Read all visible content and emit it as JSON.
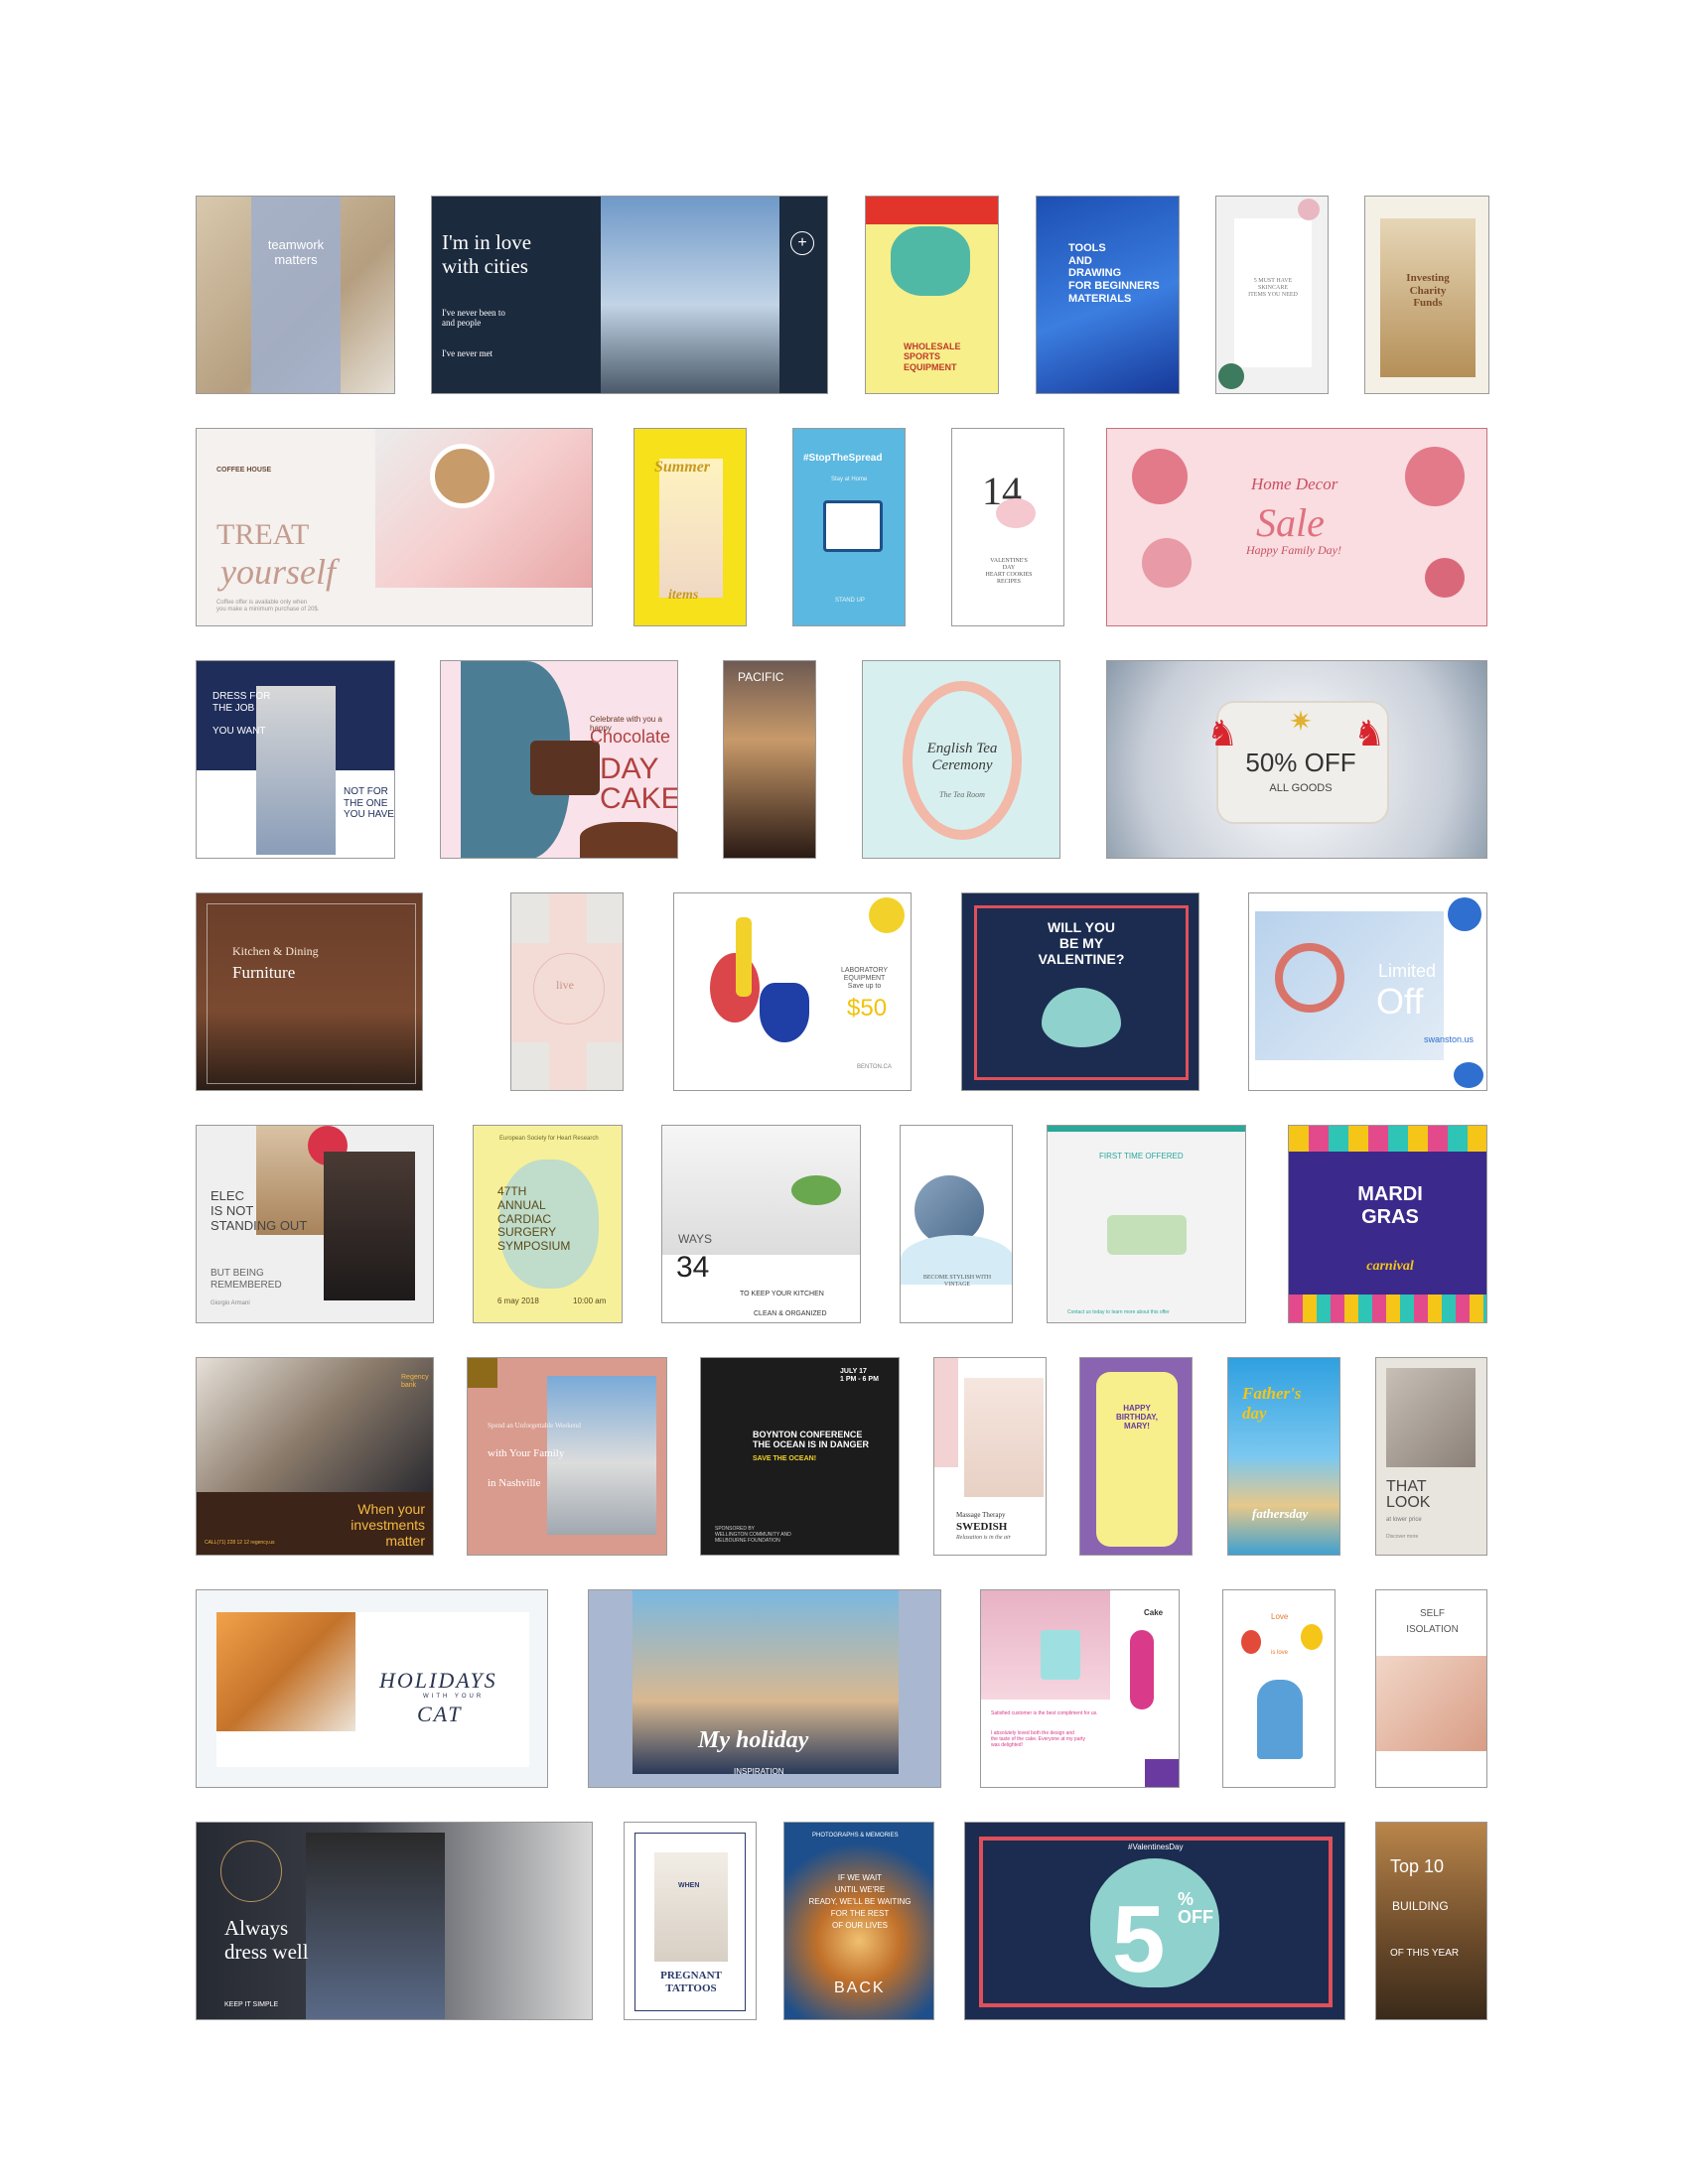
{
  "gallery": {
    "rows": [
      {
        "tiles": [
          {
            "id": "teamwork",
            "bg": "#c7b59a",
            "texts": [
              "teamwork\nmatters"
            ]
          },
          {
            "id": "cities",
            "bg": "#1c2a3e",
            "texts": [
              "I'm in love\nwith cities",
              "I've never been to\nand people",
              "I've never met"
            ]
          },
          {
            "id": "sports",
            "bg": "#f7ef8a",
            "texts": [
              "WHOLESALE\nSPORTS\nEQUIPMENT"
            ]
          },
          {
            "id": "tools",
            "bg": "#2a5fc4",
            "texts": [
              "TOOLS\nAND\nDRAWING\nFOR BEGINNERS\nMATERIALS"
            ]
          },
          {
            "id": "skincare",
            "bg": "#f3f3f3",
            "texts": [
              "5 MUST HAVE\nSKINCARE\nITEMS YOU NEED"
            ]
          },
          {
            "id": "charity",
            "bg": "#f4efe6",
            "texts": [
              "Investing\nCharity\nFunds"
            ]
          }
        ]
      },
      {
        "tiles": [
          {
            "id": "treat",
            "bg": "#f4f1ee",
            "texts": [
              "COFFEE HOUSE",
              "TREAT",
              "yourself",
              "Coffee offer is available only when\nyou make a minimum purchase of 20$."
            ]
          },
          {
            "id": "summer",
            "bg": "#f7e11a",
            "texts": [
              "Summer",
              "items"
            ]
          },
          {
            "id": "spread",
            "bg": "#5bb8e0",
            "texts": [
              "#StopTheSpread",
              "Stay at Home",
              "STAND UP"
            ]
          },
          {
            "id": "valentine14",
            "bg": "#ffffff",
            "texts": [
              "14",
              "VALENTINE'S\nDAY\nHEART COOKIES\nRECIPES"
            ]
          },
          {
            "id": "homedecor",
            "bg": "#f9dde0",
            "texts": [
              "Home Decor",
              "Sale",
              "Happy Family Day!"
            ]
          }
        ]
      },
      {
        "tiles": [
          {
            "id": "dress",
            "bg": "#ffffff",
            "texts": [
              "DRESS FOR\nTHE JOB\n\nYOU WANT",
              "NOT FOR\nTHE ONE\nYOU HAVE"
            ]
          },
          {
            "id": "cake",
            "bg": "#f9e2ea",
            "texts": [
              "Celebrate with you a happy",
              "Chocolate",
              "DAY\nCAKE"
            ]
          },
          {
            "id": "pacific",
            "bg": "#5a3a2e",
            "texts": [
              "PACIFIC"
            ]
          },
          {
            "id": "tea",
            "bg": "#d7f0ef",
            "texts": [
              "English Tea\nCeremony",
              "The Tea Room"
            ]
          },
          {
            "id": "sale50",
            "bg": "#d9dde3",
            "texts": [
              "50% OFF",
              "ALL GOODS"
            ]
          }
        ]
      },
      {
        "tiles": [
          {
            "id": "kitchen",
            "bg": "#5e3a28",
            "texts": [
              "Kitchen & Dining",
              "Furniture"
            ]
          },
          {
            "id": "live",
            "bg": "#f4dcd6",
            "texts": [
              "live"
            ]
          },
          {
            "id": "lab",
            "bg": "#ffffff",
            "texts": [
              "LABORATORY\nEQUIPMENT\nSave up to",
              "$50",
              "BENTON.CA"
            ]
          },
          {
            "id": "willyou",
            "bg": "#1b2c50",
            "texts": [
              "WILL YOU\nBE MY\nVALENTINE?"
            ]
          },
          {
            "id": "limited",
            "bg": "#e8eef5",
            "texts": [
              "Limited",
              "Off",
              "swanston.us"
            ]
          }
        ]
      },
      {
        "tiles": [
          {
            "id": "elec",
            "bg": "#efefef",
            "texts": [
              "ELEC\nIS NOT\nSTANDING OUT",
              "BUT BEING\nREMEMBERED",
              "Giorgio Armani"
            ]
          },
          {
            "id": "cardiac",
            "bg": "#f7f09a",
            "texts": [
              "European Society for Heart Research",
              "47TH\nANNUAL\nCARDIAC\nSURGERY\nSYMPOSIUM",
              "6 may 2018",
              "10:00 am"
            ]
          },
          {
            "id": "ways",
            "bg": "#ffffff",
            "texts": [
              "WAYS",
              "34",
              "TO KEEP YOUR KITCHEN",
              "CLEAN & ORGANIZED"
            ]
          },
          {
            "id": "denim",
            "bg": "#ffffff",
            "texts": [
              "BECOME STYLISH WITH\nVINTAGE"
            ]
          },
          {
            "id": "firsttime",
            "bg": "#f3f3f3",
            "texts": [
              "FIRST TIME OFFERED",
              "Contact us today to learn more about this offer"
            ]
          },
          {
            "id": "mardi",
            "bg": "#3b2a8c",
            "texts": [
              "MARDI\nGRAS",
              "carnival"
            ]
          }
        ]
      },
      {
        "tiles": [
          {
            "id": "investments",
            "bg": "#3c2418",
            "texts": [
              "Regency\nbank",
              "When your\ninvestments\nmatter",
              "CALL(71) 228 12 12 regency.us"
            ]
          },
          {
            "id": "nashville",
            "bg": "#d99b8d",
            "texts": [
              "Spend an Unforgettable Weekend",
              "with Your Family",
              "in Nashville"
            ]
          },
          {
            "id": "boynton",
            "bg": "#1c1c1c",
            "texts": [
              "JULY 17\n1 PM - 6 PM",
              "BOYNTON CONFERENCE\nTHE OCEAN IS IN DANGER",
              "SAVE THE OCEAN!",
              "SPONSORED BY\nWELLINGTON COMMUNITY AND\nMELBOURNE FOUNDATION"
            ]
          },
          {
            "id": "massage",
            "bg": "#ffffff",
            "texts": [
              "Massage Therapy",
              "SWEDISH",
              "Relaxation is in the air"
            ]
          },
          {
            "id": "birthday",
            "bg": "#8a64b0",
            "texts": [
              "HAPPY\nBIRTHDAY,\nMARY!"
            ]
          },
          {
            "id": "fathers",
            "bg": "#2fa0e0",
            "texts": [
              "Father's\nday",
              "fathersday"
            ]
          },
          {
            "id": "thatlook",
            "bg": "#e8e4de",
            "texts": [
              "THAT\nLOOK",
              "at lower price",
              "Discover more"
            ]
          }
        ]
      },
      {
        "tiles": [
          {
            "id": "cat",
            "bg": "#f2f6f8",
            "texts": [
              "HOLIDAYS",
              "WITH YOUR",
              "CAT"
            ]
          },
          {
            "id": "holiday",
            "bg": "#a9b7d0",
            "texts": [
              "My holiday",
              "INSPIRATION"
            ]
          },
          {
            "id": "cakecard",
            "bg": "#ffffff",
            "texts": [
              "Cake",
              "Satisfied customer is the best compliment for us.",
              "I absolutely loved both the design and\nthe taste of the cake. Everyone at my party\nwas delighted!"
            ]
          },
          {
            "id": "love",
            "bg": "#ffffff",
            "texts": [
              "Love",
              "is love"
            ]
          },
          {
            "id": "isolation",
            "bg": "#ffffff",
            "texts": [
              "SELF\nISOLATION"
            ]
          }
        ]
      },
      {
        "tiles": [
          {
            "id": "always",
            "bg": "#262a33",
            "texts": [
              "Always\ndress well",
              "KEEP IT SIMPLE"
            ]
          },
          {
            "id": "pregnant",
            "bg": "#ffffff",
            "texts": [
              "WHEN",
              "PREGNANT\nTATTOOS"
            ]
          },
          {
            "id": "back",
            "bg": "#1c4f8c",
            "texts": [
              "PHOTOGRAPHS & MEMORIES",
              "IF WE WAIT\nUNTIL WE'RE\nREADY, WE'LL BE WAITING\nFOR THE REST\nOF OUR LIVES",
              "BACK"
            ]
          },
          {
            "id": "vday5",
            "bg": "#1b2c50",
            "texts": [
              "#ValentinesDay",
              "5",
              "%\nOFF"
            ]
          },
          {
            "id": "top10",
            "bg": "#7a5a3a",
            "texts": [
              "Top 10",
              "BUILDING",
              "OF THIS YEAR"
            ]
          }
        ]
      }
    ]
  }
}
